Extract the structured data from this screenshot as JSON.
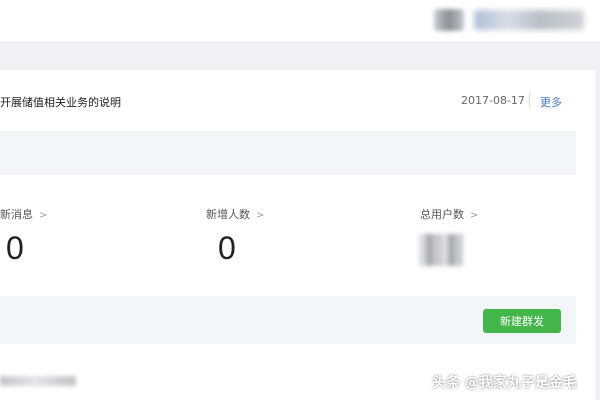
{
  "notice": {
    "title": "开展储值相关业务的说明",
    "date": "2017-08-17",
    "more": "更多"
  },
  "stats": [
    {
      "label": "新消息",
      "value": "0"
    },
    {
      "label": "新增人数",
      "value": "0"
    },
    {
      "label": "总用户数",
      "value": ""
    }
  ],
  "icons": {
    "chevron": "chevron-right-icon"
  },
  "actions": {
    "new_mass_message": "新建群发"
  },
  "watermark": "头条 @我家丸子是金毛",
  "colors": {
    "accent_green": "#44b549",
    "link_blue": "#4a7bbf",
    "band_gray": "#f3f6f8"
  }
}
